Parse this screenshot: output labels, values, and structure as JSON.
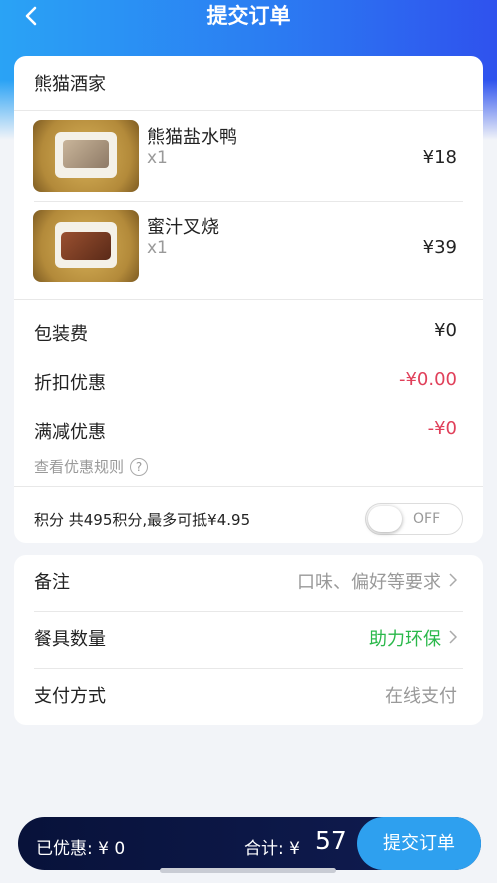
{
  "header": {
    "title": "提交订单",
    "back_icon": "chevron-left-icon"
  },
  "shop": {
    "name": "熊猫酒家"
  },
  "items": [
    {
      "name": "熊猫盐水鸭",
      "qty": "x1",
      "price": "¥18"
    },
    {
      "name": "蜜汁叉烧",
      "qty": "x1",
      "price": "¥39"
    }
  ],
  "fees": {
    "packaging": {
      "label": "包装费",
      "value": "¥0"
    },
    "discount": {
      "label": "折扣优惠",
      "value": "-¥0.00"
    },
    "full_reduction": {
      "label": "满减优惠",
      "value": "-¥0"
    }
  },
  "rules_link": "查看优惠规则",
  "help_icon_glyph": "?",
  "points": {
    "text": "积分 共495积分,最多可抵¥4.95",
    "toggle_state": "OFF"
  },
  "extras": {
    "remark": {
      "label": "备注",
      "value": "口味、偏好等要求"
    },
    "tableware": {
      "label": "餐具数量",
      "value": "助力环保"
    },
    "payment": {
      "label": "支付方式",
      "value": "在线支付"
    }
  },
  "footer": {
    "discount_text": "已优惠: ¥ 0",
    "total_label": "合计: ¥",
    "total_value": "57",
    "submit_label": "提交订单"
  },
  "colors": {
    "header_gradient_start": "#2aa3f5",
    "header_gradient_end": "#2f52ee",
    "discount_red": "#e0405a",
    "eco_green": "#2ab84a",
    "submit_blue": "#2ea0ef",
    "bottom_bar": "#08123a"
  }
}
